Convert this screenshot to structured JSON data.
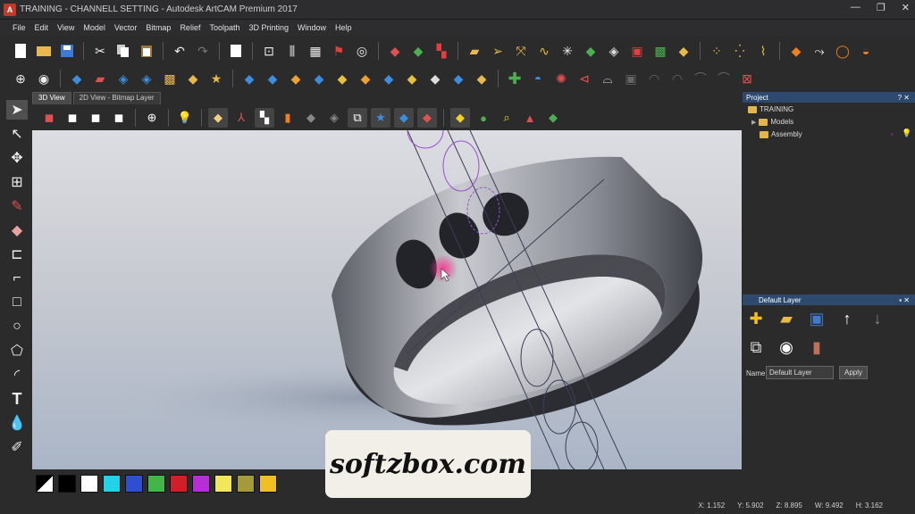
{
  "window": {
    "title": "TRAINING - CHANNELL SETTING - Autodesk ArtCAM Premium 2017",
    "app_icon": "artcam-logo-icon",
    "controls": [
      "—",
      "❐",
      "✕"
    ]
  },
  "menu": [
    "File",
    "Edit",
    "View",
    "Model",
    "Vector",
    "Bitmap",
    "Relief",
    "Toolpath",
    "3D Printing",
    "Window",
    "Help"
  ],
  "tabs": [
    {
      "label": "3D View",
      "active": true
    },
    {
      "label": "2D View - Bitmap Layer",
      "active": false
    }
  ],
  "project_panel": {
    "title": "Project",
    "controls": "? ✕",
    "tree": [
      {
        "label": "TRAINING",
        "level": 0
      },
      {
        "label": "Models",
        "level": 1
      },
      {
        "label": "Assembly",
        "level": 1
      }
    ]
  },
  "layer_panel": {
    "title": "Default Layer",
    "name_label": "Name:",
    "name_value": "Default Layer",
    "apply_label": "Apply"
  },
  "palette_colors": [
    "#000000",
    "#ffffff",
    "#22d3e8",
    "#2e4fd1",
    "#43b649",
    "#d11f2a",
    "#b52fd4",
    "#f2e65a",
    "#a39a3b",
    "#f0c020"
  ],
  "status": {
    "x": "X: 1.152",
    "y": "Y: 5.902",
    "z": "Z: 8.895",
    "w": "W: 9.492",
    "h": "H: 3.162"
  },
  "watermark": "softzbox.com"
}
